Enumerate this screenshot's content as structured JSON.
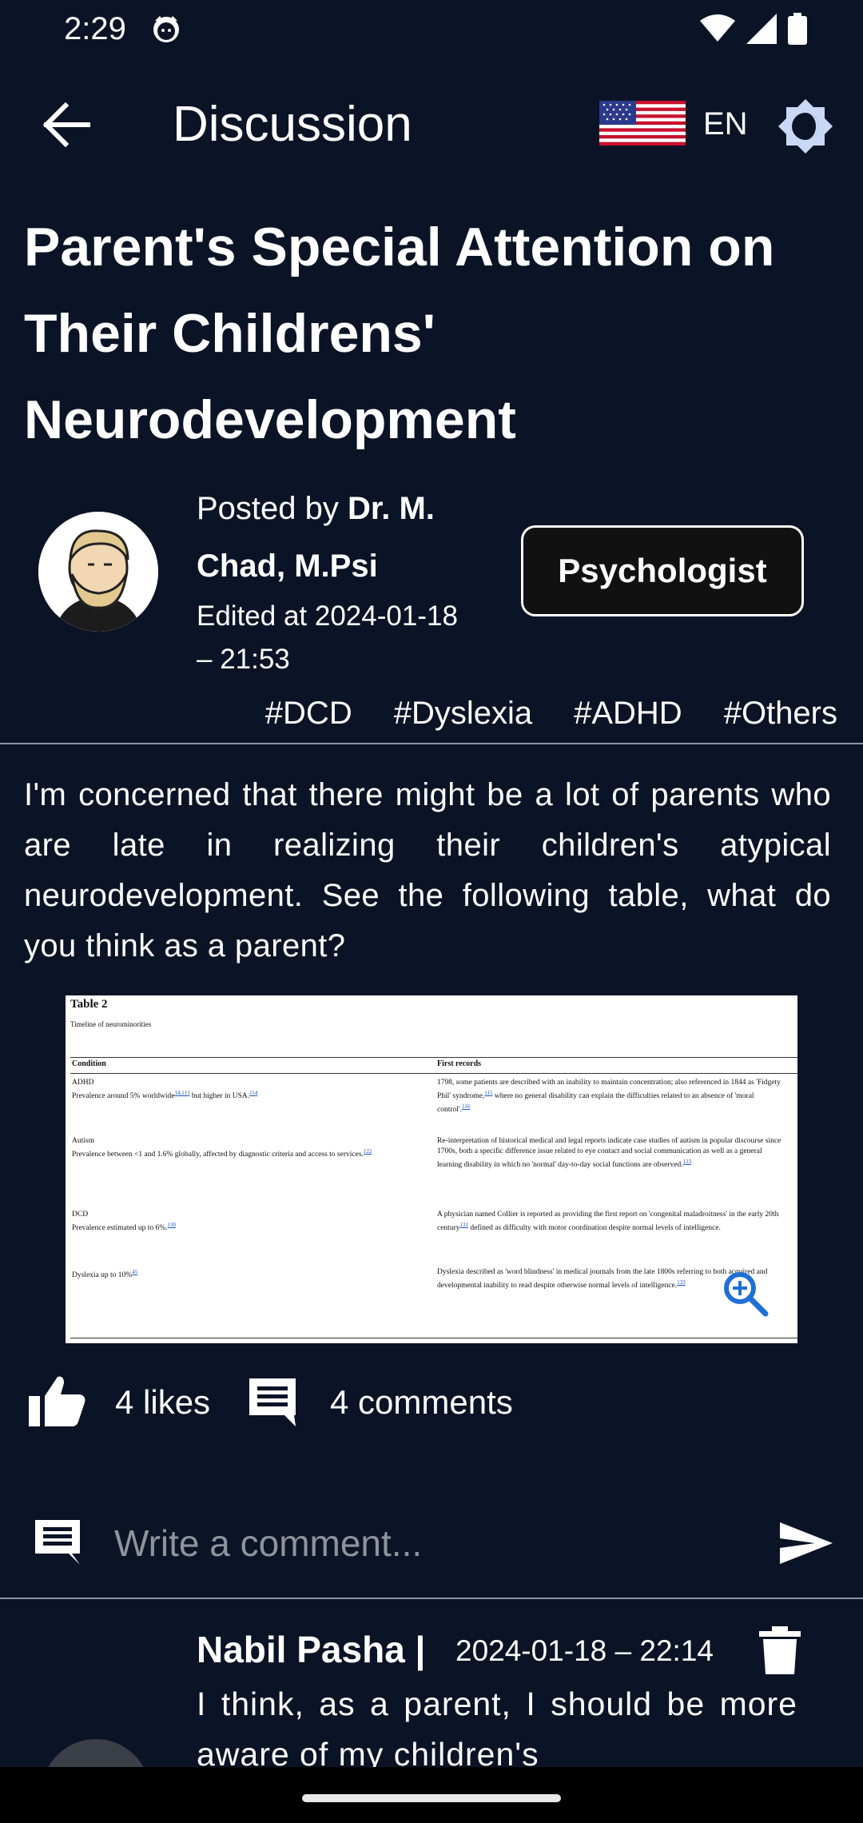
{
  "status_bar": {
    "time": "2:29"
  },
  "app_bar": {
    "title": "Discussion",
    "language": "EN"
  },
  "post": {
    "title": "Parent's Special Attention on Their Childrens' Neurodevelopment",
    "posted_by_label": "Posted by",
    "author_line1": "Dr. M.",
    "author_line2": "Chad, M.Psi",
    "edited_line1": "Edited at 2024-01-18",
    "edited_line2": "– 21:53",
    "role": "Psychologist",
    "tags": [
      "#DCD",
      "#Dyslexia",
      "#ADHD",
      "#Others"
    ],
    "body": "I'm concerned that there might be a lot of parents who are late in realizing their children's atypical neurodevelopment. See the following table, what do you think as a parent?",
    "likes": "4 likes",
    "comments": "4 comments"
  },
  "attachment": {
    "table_title": "Table 2",
    "table_subtitle": "Timeline of neurominorities",
    "col1": "Condition",
    "col2": "First records",
    "rows": [
      {
        "cond_name": "ADHD",
        "cond_detail": "Prevalence around 5% worldwide",
        "cond_ref": "14,113",
        "cond_tail": " but higher in USA.",
        "cond_ref2": "114",
        "record": "1798, some patients are described with an inability to maintain concentration; also referenced in 1844 as 'Fidgety Phil' syndrome,",
        "record_ref": "115",
        "record_tail": " where no general disability can explain the difficulties related to an absence of 'moral control'.",
        "record_ref2": "116"
      },
      {
        "cond_name": "Autism",
        "cond_detail": "Prevalence between <1 and 1.6% globally, affected by diagnostic criteria and access to services.",
        "cond_ref": "122",
        "record": "Re-interpretation of historical medical and legal reports indicate case studies of autism in popular discourse since 1700s, both a specific difference issue related to eye contact and social communication as well as a general learning disability in which no 'normal' day-to-day social functions are observed.",
        "record_ref": "123"
      },
      {
        "cond_name": "DCD",
        "cond_detail": "Prevalence estimated up to 6%.",
        "cond_ref": "130",
        "record": "A physician named Collier is reported as providing the first report on 'congenital maladroitness' in the early 20th century",
        "record_ref": "131",
        "record_tail": " defined as difficulty with motor coordination despite normal levels of intelligence."
      },
      {
        "cond_name": "Dyslexia up to 10%",
        "cond_ref": "45",
        "record": "Dyslexia described as 'word blindness' in medical journals from the late 1800s referring to both acquired and developmental inability to read despite otherwise normal levels of intelligence.",
        "record_ref": "133"
      }
    ]
  },
  "comment_input": {
    "placeholder": "Write a comment..."
  },
  "comment": {
    "author": "Nabil Pasha |",
    "date": "2024-01-18 – 22:14",
    "text": "I think, as a parent, I should be more aware of my children's"
  },
  "icons": {
    "back": "arrow-back-icon",
    "flag": "us-flag-icon",
    "theme": "brightness-icon",
    "zoom": "zoom-in-icon",
    "like": "thumb-up-icon",
    "comment": "comment-icon",
    "send": "send-icon",
    "trash": "trash-icon"
  },
  "colors": {
    "background": "#0b1426",
    "zoom": "#1f6fd6",
    "divider": "#8c94a3"
  }
}
